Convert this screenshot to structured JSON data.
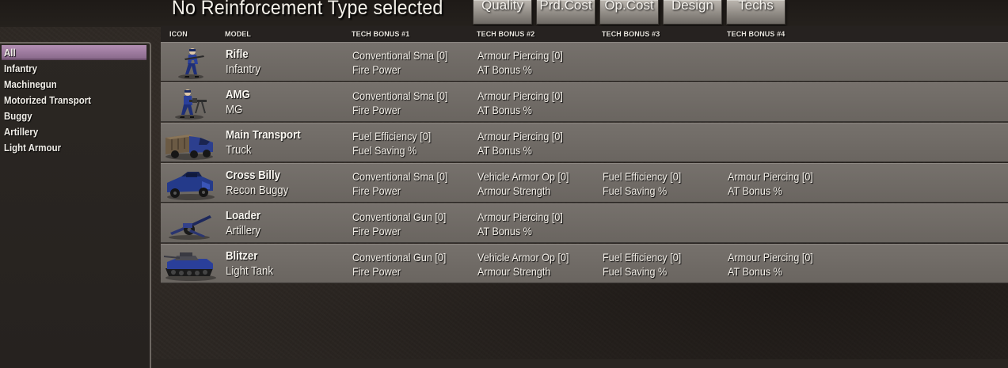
{
  "header": {
    "title": "No Reinforcement Type selected"
  },
  "sort_buttons": [
    {
      "label": "Quality"
    },
    {
      "label": "Prd.Cost"
    },
    {
      "label": "Op.Cost"
    },
    {
      "label": "Design"
    },
    {
      "label": "Techs"
    }
  ],
  "columns": {
    "icon": "ICON",
    "model": "MODEL",
    "tech1": "TECH BONUS #1",
    "tech2": "TECH BONUS #2",
    "tech3": "TECH BONUS #3",
    "tech4": "TECH BONUS #4"
  },
  "sidebar": {
    "selected_index": 0,
    "items": [
      {
        "label": "All"
      },
      {
        "label": "Infantry"
      },
      {
        "label": "Machinegun"
      },
      {
        "label": "Motorized Transport"
      },
      {
        "label": "Buggy"
      },
      {
        "label": "Artillery"
      },
      {
        "label": "Light Armour"
      }
    ]
  },
  "rows": [
    {
      "name": "Rifle",
      "type": "Infantry",
      "icon": "rifleman-icon",
      "tech1": [
        "Conventional Sma [0]",
        "Fire Power"
      ],
      "tech2": [
        "Armour Piercing  [0]",
        "AT Bonus %"
      ],
      "tech3": [
        "",
        ""
      ],
      "tech4": [
        "",
        ""
      ]
    },
    {
      "name": "AMG",
      "type": "MG",
      "icon": "machinegunner-icon",
      "tech1": [
        "Conventional Sma [0]",
        "Fire Power"
      ],
      "tech2": [
        "Armour Piercing  [0]",
        "AT Bonus %"
      ],
      "tech3": [
        "",
        ""
      ],
      "tech4": [
        "",
        ""
      ]
    },
    {
      "name": "Main Transport",
      "type": "Truck",
      "icon": "truck-icon",
      "tech1": [
        "Fuel Efficiency [0]",
        "Fuel Saving %"
      ],
      "tech2": [
        "Armour Piercing  [0]",
        "AT Bonus %"
      ],
      "tech3": [
        "",
        ""
      ],
      "tech4": [
        "",
        ""
      ]
    },
    {
      "name": "Cross Billy",
      "type": "Recon Buggy",
      "icon": "buggy-icon",
      "tech1": [
        "Conventional Sma [0]",
        "Fire Power"
      ],
      "tech2": [
        "Vehicle Armor Op [0]",
        "Armour Strength"
      ],
      "tech3": [
        "Fuel Efficiency [0]",
        "Fuel Saving %"
      ],
      "tech4": [
        "Armour Piercing  [0]",
        "AT Bonus %"
      ]
    },
    {
      "name": "Loader",
      "type": "Artillery",
      "icon": "artillery-icon",
      "tech1": [
        "Conventional Gun [0]",
        "Fire Power"
      ],
      "tech2": [
        "Armour Piercing  [0]",
        "AT Bonus %"
      ],
      "tech3": [
        "",
        ""
      ],
      "tech4": [
        "",
        ""
      ]
    },
    {
      "name": "Blitzer",
      "type": "Light Tank",
      "icon": "tank-icon",
      "tech1": [
        "Conventional Gun [0]",
        "Fire Power"
      ],
      "tech2": [
        "Vehicle Armor Op [0]",
        "Armour Strength"
      ],
      "tech3": [
        "Fuel Efficiency [0]",
        "Fuel Saving %"
      ],
      "tech4": [
        "Armour Piercing  [0]",
        "AT Bonus %"
      ]
    }
  ]
}
